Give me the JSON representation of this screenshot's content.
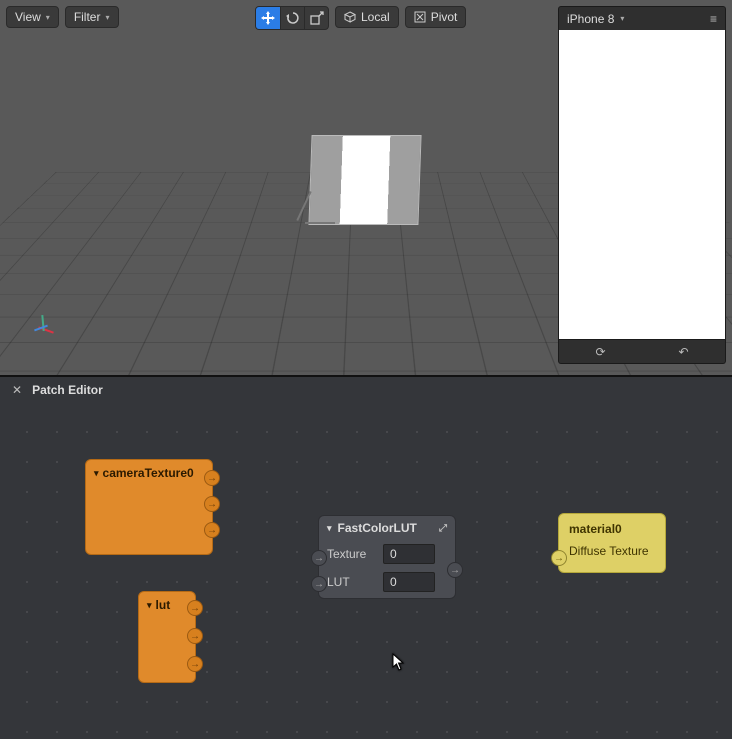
{
  "toolbar": {
    "view_label": "View",
    "filter_label": "Filter",
    "local_label": "Local",
    "pivot_label": "Pivot"
  },
  "center_tools": {
    "move_tooltip": "Move",
    "rotate_tooltip": "Rotate",
    "scale_tooltip": "Scale"
  },
  "preview": {
    "device": "iPhone 8"
  },
  "patch_editor": {
    "title": "Patch Editor"
  },
  "nodes": {
    "camera_texture": {
      "title": "cameraTexture0"
    },
    "lut_node": {
      "title": "lut"
    },
    "fast_color_lut": {
      "title": "FastColorLUT",
      "texture_label": "Texture",
      "texture_value": "0",
      "lut_label": "LUT",
      "lut_value": "0"
    },
    "material": {
      "title": "material0",
      "row_label": "Diffuse Texture"
    }
  }
}
